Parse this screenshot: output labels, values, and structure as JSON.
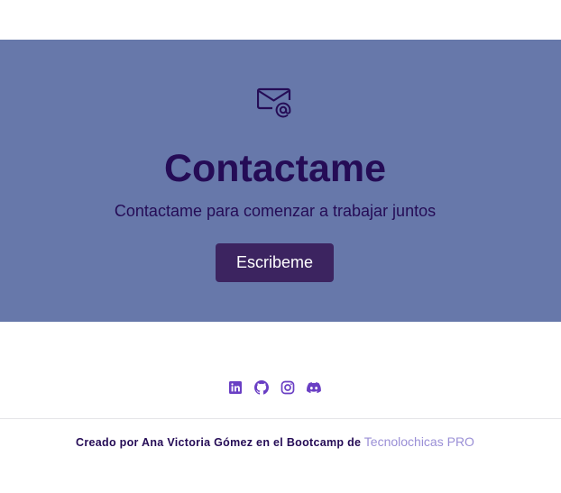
{
  "contact": {
    "icon": "mail-at-icon",
    "title": "Contactame",
    "subtitle": "Contactame para comenzar a trabajar juntos",
    "button_label": "Escribeme"
  },
  "social": [
    {
      "icon": "linkedin-icon"
    },
    {
      "icon": "github-icon"
    },
    {
      "icon": "instagram-icon"
    },
    {
      "icon": "discord-icon"
    }
  ],
  "footer": {
    "credit_text": "Creado por Ana Victoria Gómez en el Bootcamp de",
    "credit_link": "Tecnolochicas PRO"
  },
  "colors": {
    "section_bg": "#6778aa",
    "title_text": "#250c56",
    "button_bg": "#3c2460",
    "social_icon": "#6a3fc4",
    "link_text": "#9a8fd6"
  }
}
